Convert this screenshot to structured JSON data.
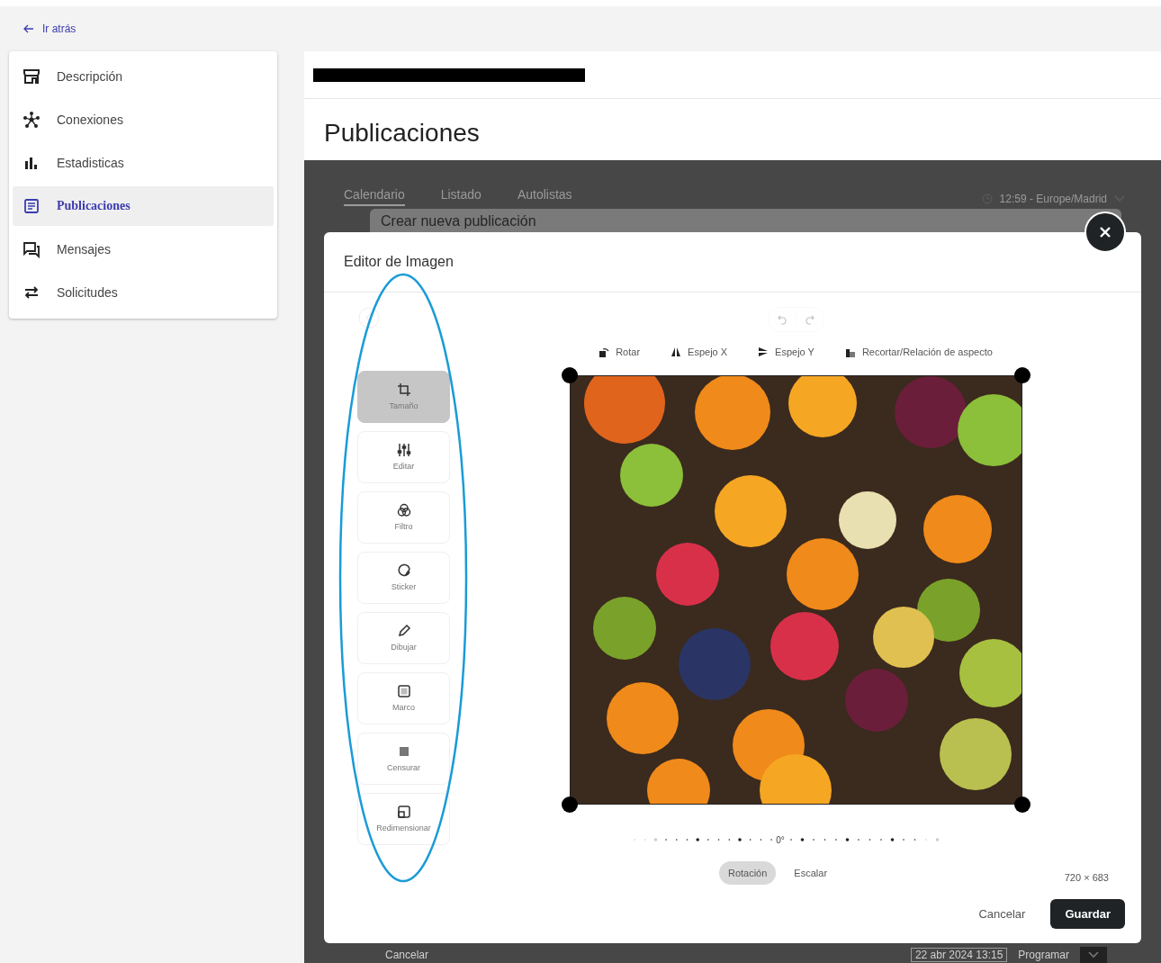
{
  "back_link": "Ir atrás",
  "sidebar": {
    "items": [
      {
        "label": "Descripción",
        "selected": false
      },
      {
        "label": "Conexiones",
        "selected": false
      },
      {
        "label": "Estadisticas",
        "selected": false
      },
      {
        "label": "Publicaciones",
        "selected": true
      },
      {
        "label": "Mensajes",
        "selected": false
      },
      {
        "label": "Solicitudes",
        "selected": false
      }
    ]
  },
  "header": {
    "title": "Publicaciones"
  },
  "background": {
    "tabs": [
      {
        "label": "Calendario",
        "selected": true
      },
      {
        "label": "Listado",
        "selected": false
      },
      {
        "label": "Autolistas",
        "selected": false
      }
    ],
    "timezone": "12:59 - Europe/Madrid",
    "dialog_title": "Crear nueva publicación",
    "footer_cancel": "Cancelar",
    "date": "22 abr 2024 13:15",
    "schedule_button": "Programar"
  },
  "editor": {
    "title": "Editor de Imagen",
    "undo_disabled": true,
    "tools": [
      {
        "label": "Tamaño",
        "selected": true
      },
      {
        "label": "Editar",
        "selected": false
      },
      {
        "label": "Filtro",
        "selected": false
      },
      {
        "label": "Sticker",
        "selected": false
      },
      {
        "label": "Dibujar",
        "selected": false
      },
      {
        "label": "Marco",
        "selected": false
      },
      {
        "label": "Censurar",
        "selected": false
      },
      {
        "label": "Redimensionar",
        "selected": false
      }
    ],
    "actions": [
      "Rotar",
      "Espejo X",
      "Espejo Y",
      "Recortar/Relación de aspecto"
    ],
    "dial_reading": "0°",
    "modes": [
      {
        "label": "Rotación",
        "selected": true
      },
      {
        "label": "Escalar",
        "selected": false
      }
    ],
    "dimensions": "720 × 683",
    "cancel_button": "Cancelar",
    "save_button": "Guardar"
  }
}
